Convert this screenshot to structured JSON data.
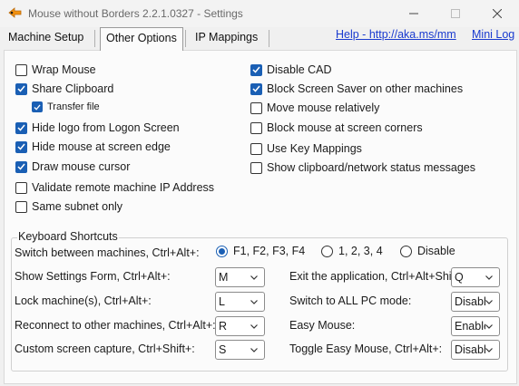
{
  "window": {
    "title": "Mouse without Borders 2.2.1.0327 - Settings"
  },
  "tabs": {
    "machine_setup": "Machine Setup",
    "other_options": "Other Options",
    "ip_mappings": "IP Mappings"
  },
  "links": {
    "help": "Help - http://aka.ms/mm",
    "mini_log": "Mini Log"
  },
  "left_options": [
    {
      "label": "Wrap Mouse",
      "checked": false
    },
    {
      "label": "Share Clipboard",
      "checked": true
    },
    {
      "label": "Transfer file",
      "checked": true
    },
    {
      "label": "Hide logo from Logon Screen",
      "checked": true
    },
    {
      "label": "Hide mouse at screen edge",
      "checked": true
    },
    {
      "label": "Draw mouse cursor",
      "checked": true
    },
    {
      "label": "Validate remote machine IP Address",
      "checked": false
    },
    {
      "label": "Same subnet only",
      "checked": false
    }
  ],
  "right_options": [
    {
      "label": "Disable CAD",
      "checked": true
    },
    {
      "label": "Block Screen Saver on other machines",
      "checked": true
    },
    {
      "label": "Move mouse relatively",
      "checked": false
    },
    {
      "label": "Block mouse at screen corners",
      "checked": false
    },
    {
      "label": "Use Key Mappings",
      "checked": false
    },
    {
      "label": "Show clipboard/network status messages",
      "checked": false
    }
  ],
  "shortcuts": {
    "title": "Keyboard Shortcuts",
    "switch_label": "Switch between machines, Ctrl+Alt+:",
    "switch_options": [
      "F1, F2, F3, F4",
      "1, 2, 3, 4",
      "Disable"
    ],
    "switch_selected": "F1, F2, F3, F4",
    "rows_left": [
      {
        "label": "Show Settings Form, Ctrl+Alt+:",
        "value": "M"
      },
      {
        "label": "Lock machine(s), Ctrl+Alt+:",
        "value": "L"
      },
      {
        "label": "Reconnect to other machines, Ctrl+Alt+:",
        "value": "R"
      },
      {
        "label": "Custom screen capture, Ctrl+Shift+:",
        "value": "S"
      }
    ],
    "rows_right": [
      {
        "label": "Exit the application, Ctrl+Alt+Shift+:",
        "value": "Q"
      },
      {
        "label": "Switch to ALL PC mode:",
        "value": "Disable"
      },
      {
        "label": "Easy Mouse:",
        "value": "Enable"
      },
      {
        "label": "Toggle Easy Mouse, Ctrl+Alt+:",
        "value": "Disable"
      }
    ]
  },
  "colors": {
    "accent": "#1a5fb4",
    "link": "#1a3bcf",
    "background": "#f0f0f0"
  },
  "icons": {
    "app": "mouse-without-borders-icon",
    "minimize": "minimize-icon",
    "maximize": "maximize-icon",
    "close": "close-icon",
    "dropdown": "chevron-down-icon",
    "check": "checkmark-icon"
  }
}
